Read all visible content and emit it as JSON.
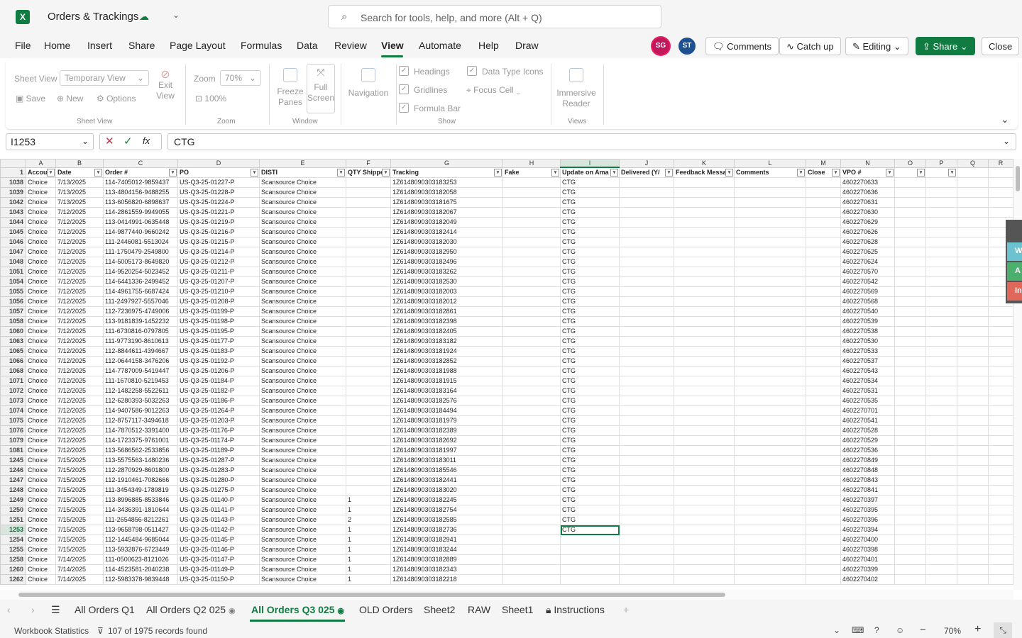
{
  "title_bar": {
    "app_icon": "excel-icon",
    "doc_title": "Orders & Trackings",
    "search_placeholder": "Search for tools, help, and more (Alt + Q)"
  },
  "menu": [
    "File",
    "Home",
    "Insert",
    "Share",
    "Page Layout",
    "Formulas",
    "Data",
    "Review",
    "View",
    "Automate",
    "Help",
    "Draw"
  ],
  "active_menu": "View",
  "avatars": [
    {
      "initials": "SG",
      "color": "#c2185b"
    },
    {
      "initials": "ST",
      "color": "#1d4f91"
    }
  ],
  "top_buttons": {
    "comments": "Comments",
    "catch_up": "Catch up",
    "editing": "Editing",
    "share": "Share",
    "close": "Close"
  },
  "ribbon": {
    "sheet_view_label": "Sheet View",
    "sheet_view_value": "Temporary View",
    "exit_view": "Exit View",
    "save": "Save",
    "new": "New",
    "options": "Options",
    "group_sheet_view": "Sheet View",
    "zoom_label": "Zoom",
    "zoom_value": "70%",
    "zoom_100": "100%",
    "group_zoom": "Zoom",
    "freeze_panes": "Freeze Panes",
    "full_screen": "Full Screen",
    "group_window": "Window",
    "navigation": "Navigation",
    "headings": "Headings",
    "gridlines": "Gridlines",
    "formula_bar": "Formula Bar",
    "data_type_icons": "Data Type Icons",
    "focus_cell": "Focus Cell",
    "group_show": "Show",
    "immersive_reader": "Immersive Reader",
    "group_views": "Views"
  },
  "formula_bar": {
    "name_box": "I1253",
    "formula": "CTG"
  },
  "columns": [
    "A",
    "B",
    "C",
    "D",
    "E",
    "F",
    "G",
    "H",
    "I",
    "J",
    "K",
    "L",
    "M",
    "N",
    "O",
    "P",
    "Q",
    "R"
  ],
  "header_row": {
    "row": "1",
    "cells": [
      "Accou",
      "Date",
      "Order #",
      "PO",
      "DISTI",
      "QTY Shippe",
      "Tracking",
      "Fake",
      "Update on Ama",
      "Delivered (Y/",
      "Feedback Messa",
      "Comments",
      "Close",
      "VPO #",
      "",
      "",
      " ",
      " "
    ]
  },
  "rows": [
    {
      "row": "1038",
      "date": "7/13/2025",
      "order": "114-7405012-9859437",
      "po": "US-Q3-25-01227-P",
      "tracking": "1Z6148090303183253",
      "vpo": "4602270633",
      "qty": "",
      "upd": "CTG"
    },
    {
      "row": "1039",
      "date": "7/13/2025",
      "order": "113-4804156-9488255",
      "po": "US-Q3-25-01228-P",
      "tracking": "1Z6148090303182058",
      "vpo": "4602270636",
      "qty": "",
      "upd": "CTG"
    },
    {
      "row": "1042",
      "date": "7/13/2025",
      "order": "113-6056820-6898637",
      "po": "US-Q3-25-01224-P",
      "tracking": "1Z6148090303181675",
      "vpo": "4602270631",
      "qty": "",
      "upd": "CTG"
    },
    {
      "row": "1043",
      "date": "7/12/2025",
      "order": "114-2861559-9949055",
      "po": "US-Q3-25-01221-P",
      "tracking": "1Z6148090303182067",
      "vpo": "4602270630",
      "qty": "",
      "upd": "CTG"
    },
    {
      "row": "1044",
      "date": "7/12/2025",
      "order": "113-0414991-0635448",
      "po": "US-Q3-25-01219-P",
      "tracking": "1Z6148090303182049",
      "vpo": "4602270629",
      "qty": "",
      "upd": "CTG"
    },
    {
      "row": "1045",
      "date": "7/12/2025",
      "order": "114-9877440-9660242",
      "po": "US-Q3-25-01216-P",
      "tracking": "1Z6148090303182414",
      "vpo": "4602270626",
      "qty": "",
      "upd": "CTG"
    },
    {
      "row": "1046",
      "date": "7/12/2025",
      "order": "111-2446081-5513024",
      "po": "US-Q3-25-01215-P",
      "tracking": "1Z6148090303182030",
      "vpo": "4602270628",
      "qty": "",
      "upd": "CTG"
    },
    {
      "row": "1047",
      "date": "7/12/2025",
      "order": "111-1750479-2549800",
      "po": "US-Q3-25-01214-P",
      "tracking": "1Z6148090303182950",
      "vpo": "4602270625",
      "qty": "",
      "upd": "CTG"
    },
    {
      "row": "1048",
      "date": "7/12/2025",
      "order": "114-5005173-8649820",
      "po": "US-Q3-25-01212-P",
      "tracking": "1Z6148090303182496",
      "vpo": "4602270624",
      "qty": "",
      "upd": "CTG"
    },
    {
      "row": "1051",
      "date": "7/12/2025",
      "order": "114-9520254-5023452",
      "po": "US-Q3-25-01211-P",
      "tracking": "1Z6148090303183262",
      "vpo": "4602270570",
      "qty": "",
      "upd": "CTG"
    },
    {
      "row": "1054",
      "date": "7/12/2025",
      "order": "114-6441336-2499452",
      "po": "US-Q3-25-01207-P",
      "tracking": "1Z6148090303182530",
      "vpo": "4602270542",
      "qty": "",
      "upd": "CTG"
    },
    {
      "row": "1055",
      "date": "7/12/2025",
      "order": "114-4961755-6687424",
      "po": "US-Q3-25-01210-P",
      "tracking": "1Z6148090303182003",
      "vpo": "4602270569",
      "qty": "",
      "upd": "CTG"
    },
    {
      "row": "1056",
      "date": "7/12/2025",
      "order": "111-2497927-5557046",
      "po": "US-Q3-25-01208-P",
      "tracking": "1Z6148090303182012",
      "vpo": "4602270568",
      "qty": "",
      "upd": "CTG"
    },
    {
      "row": "1057",
      "date": "7/12/2025",
      "order": "112-7236975-4749006",
      "po": "US-Q3-25-01199-P",
      "tracking": "1Z6148090303182861",
      "vpo": "4602270540",
      "qty": "",
      "upd": "CTG"
    },
    {
      "row": "1058",
      "date": "7/12/2025",
      "order": "113-9181839-1452232",
      "po": "US-Q3-25-01198-P",
      "tracking": "1Z6148090303182398",
      "vpo": "4602270539",
      "qty": "",
      "upd": "CTG"
    },
    {
      "row": "1060",
      "date": "7/12/2025",
      "order": "111-6730816-0797805",
      "po": "US-Q3-25-01195-P",
      "tracking": "1Z6148090303182405",
      "vpo": "4602270538",
      "qty": "",
      "upd": "CTG"
    },
    {
      "row": "1063",
      "date": "7/12/2025",
      "order": "111-9773190-8610613",
      "po": "US-Q3-25-01177-P",
      "tracking": "1Z6148090303183182",
      "vpo": "4602270530",
      "qty": "",
      "upd": "CTG"
    },
    {
      "row": "1065",
      "date": "7/12/2025",
      "order": "112-8844611-4394667",
      "po": "US-Q3-25-01183-P",
      "tracking": "1Z6148090303181924",
      "vpo": "4602270533",
      "qty": "",
      "upd": "CTG"
    },
    {
      "row": "1066",
      "date": "7/12/2025",
      "order": "112-0644158-3476206",
      "po": "US-Q3-25-01192-P",
      "tracking": "1Z6148090303182852",
      "vpo": "4602270537",
      "qty": "",
      "upd": "CTG"
    },
    {
      "row": "1068",
      "date": "7/12/2025",
      "order": "114-7787009-5419447",
      "po": "US-Q3-25-01206-P",
      "tracking": "1Z6148090303181988",
      "vpo": "4602270543",
      "qty": "",
      "upd": "CTG"
    },
    {
      "row": "1071",
      "date": "7/12/2025",
      "order": "111-1670810-5219453",
      "po": "US-Q3-25-01184-P",
      "tracking": "1Z6148090303181915",
      "vpo": "4602270534",
      "qty": "",
      "upd": "CTG"
    },
    {
      "row": "1072",
      "date": "7/12/2025",
      "order": "112-1482258-5522611",
      "po": "US-Q3-25-01182-P",
      "tracking": "1Z6148090303183164",
      "vpo": "4602270531",
      "qty": "",
      "upd": "CTG"
    },
    {
      "row": "1073",
      "date": "7/12/2025",
      "order": "112-6280393-5032263",
      "po": "US-Q3-25-01186-P",
      "tracking": "1Z6148090303182576",
      "vpo": "4602270535",
      "qty": "",
      "upd": "CTG"
    },
    {
      "row": "1074",
      "date": "7/12/2025",
      "order": "114-9407586-9012263",
      "po": "US-Q3-25-01264-P",
      "tracking": "1Z6148090303184494",
      "vpo": "4602270701",
      "qty": "",
      "upd": "CTG"
    },
    {
      "row": "1075",
      "date": "7/12/2025",
      "order": "112-8757117-3494618",
      "po": "US-Q3-25-01203-P",
      "tracking": "1Z6148090303181979",
      "vpo": "4602270541",
      "qty": "",
      "upd": "CTG"
    },
    {
      "row": "1076",
      "date": "7/12/2025",
      "order": "114-7870512-3391400",
      "po": "US-Q3-25-01176-P",
      "tracking": "1Z6148090303182389",
      "vpo": "4602270528",
      "qty": "",
      "upd": "CTG"
    },
    {
      "row": "1079",
      "date": "7/12/2025",
      "order": "114-1723375-9761001",
      "po": "US-Q3-25-01174-P",
      "tracking": "1Z6148090303182692",
      "vpo": "4602270529",
      "qty": "",
      "upd": "CTG"
    },
    {
      "row": "1081",
      "date": "7/12/2025",
      "order": "113-5686562-2533856",
      "po": "US-Q3-25-01189-P",
      "tracking": "1Z6148090303181997",
      "vpo": "4602270536",
      "qty": "",
      "upd": "CTG"
    },
    {
      "row": "1245",
      "date": "7/15/2025",
      "order": "113-5575563-1480236",
      "po": "US-Q3-25-01287-P",
      "tracking": "1Z6148090303183011",
      "vpo": "4602270849",
      "qty": "",
      "upd": "CTG"
    },
    {
      "row": "1246",
      "date": "7/15/2025",
      "order": "112-2870929-8601800",
      "po": "US-Q3-25-01283-P",
      "tracking": "1Z6148090303185546",
      "vpo": "4602270848",
      "qty": "",
      "upd": "CTG"
    },
    {
      "row": "1247",
      "date": "7/15/2025",
      "order": "112-1910461-7082666",
      "po": "US-Q3-25-01280-P",
      "tracking": "1Z6148090303182441",
      "vpo": "4602270843",
      "qty": "",
      "upd": "CTG"
    },
    {
      "row": "1248",
      "date": "7/15/2025",
      "order": "111-3454349-1789819",
      "po": "US-Q3-25-01275-P",
      "tracking": "1Z6148090303183020",
      "vpo": "4602270841",
      "qty": "",
      "upd": "CTG"
    },
    {
      "row": "1249",
      "date": "7/15/2025",
      "order": "113-8996885-8533846",
      "po": "US-Q3-25-01140-P",
      "tracking": "1Z6148090303182245",
      "vpo": "4602270397",
      "qty": "1",
      "upd": "CTG"
    },
    {
      "row": "1250",
      "date": "7/15/2025",
      "order": "114-3436391-1810644",
      "po": "US-Q3-25-01141-P",
      "tracking": "1Z6148090303182754",
      "vpo": "4602270395",
      "qty": "1",
      "upd": "CTG"
    },
    {
      "row": "1251",
      "date": "7/15/2025",
      "order": "111-2654856-8212261",
      "po": "US-Q3-25-01143-P",
      "tracking": "1Z6148090303182585",
      "vpo": "4602270396",
      "qty": "2",
      "upd": "CTG"
    },
    {
      "row": "1253",
      "date": "7/15/2025",
      "order": "113-9658798-0511427",
      "po": "US-Q3-25-01142-P",
      "tracking": "1Z6148090303182736",
      "vpo": "4602270394",
      "qty": "1",
      "upd": "CTG"
    },
    {
      "row": "1254",
      "date": "7/15/2025",
      "order": "112-1445484-9685044",
      "po": "US-Q3-25-01145-P",
      "tracking": "1Z6148090303182941",
      "vpo": "4602270400",
      "qty": "1",
      "upd": ""
    },
    {
      "row": "1255",
      "date": "7/15/2025",
      "order": "113-5932876-6723449",
      "po": "US-Q3-25-01146-P",
      "tracking": "1Z6148090303183244",
      "vpo": "4602270398",
      "qty": "1",
      "upd": ""
    },
    {
      "row": "1258",
      "date": "7/14/2025",
      "order": "111-0500623-8121026",
      "po": "US-Q3-25-01147-P",
      "tracking": "1Z6148090303182889",
      "vpo": "4602270401",
      "qty": "1",
      "upd": ""
    },
    {
      "row": "1260",
      "date": "7/14/2025",
      "order": "114-4523581-2040238",
      "po": "US-Q3-25-01149-P",
      "tracking": "1Z6148090303182343",
      "vpo": "4602270399",
      "qty": "1",
      "upd": ""
    },
    {
      "row": "1262",
      "date": "7/14/2025",
      "order": "112-5983378-9839448",
      "po": "US-Q3-25-01150-P",
      "tracking": "1Z6148090303182218",
      "vpo": "4602270402",
      "qty": "1",
      "upd": ""
    }
  ],
  "account_value": "Choice",
  "disti_value": "Scansource Choice",
  "active_row": "1253",
  "sheet_tabs": [
    "All Orders Q1",
    "All Orders Q2 025",
    "All Orders Q3 025",
    "OLD Orders",
    "Sheet2",
    "RAW",
    "Sheet1",
    "Instructions"
  ],
  "active_tab": "All Orders Q3 025",
  "status": {
    "workbook_stats": "Workbook Statistics",
    "records": "107 of 1975 records found",
    "zoom": "70%"
  },
  "side_tabs": [
    {
      "letter": "W",
      "color": "#6cc3cf"
    },
    {
      "letter": "A",
      "color": "#4caf6d"
    },
    {
      "letter": "In",
      "color": "#e0675a"
    }
  ]
}
